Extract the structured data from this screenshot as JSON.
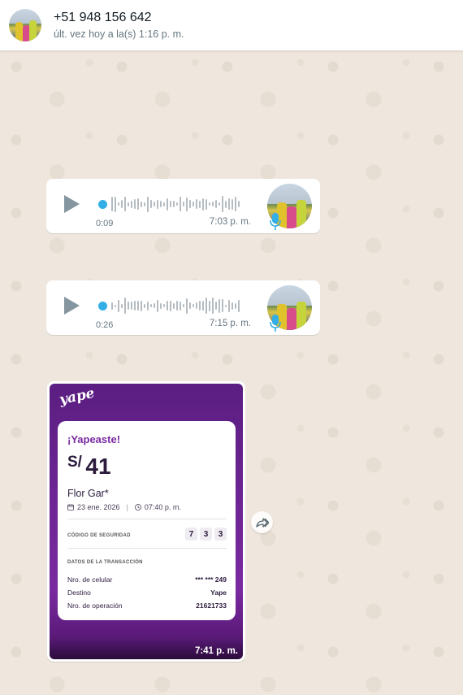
{
  "header": {
    "contact_name": "+51 948 156 642",
    "last_seen": "últ. vez hoy a la(s) 1:16 p. m."
  },
  "voice_notes": [
    {
      "duration": "0:09",
      "time": "7:03 p. m."
    },
    {
      "duration": "0:26",
      "time": "7:15 p. m."
    }
  ],
  "image_message": {
    "time": "7:41 p. m.",
    "yape": {
      "logo": "yape",
      "title": "¡Yapeaste!",
      "currency": "S/",
      "amount": "41",
      "recipient": "Flor Gar*",
      "date": "23 ene. 2026",
      "time": "07:40 p. m.",
      "security_label": "CÓDIGO DE SEGURIDAD",
      "security_code": [
        "7",
        "3",
        "3"
      ],
      "section_label": "DATOS DE LA TRANSACCIÓN",
      "rows": [
        {
          "label": "Nro. de celular",
          "value": "*** *** 249"
        },
        {
          "label": "Destino",
          "value": "Yape"
        },
        {
          "label": "Nro. de operación",
          "value": "21621733"
        }
      ]
    }
  },
  "colors": {
    "chat_background": "#efe7dd",
    "wave_progress": "#34aee6",
    "yape_purple": "#7a2aa0"
  },
  "icons": [
    "play-icon",
    "mic-icon",
    "forward-icon",
    "calendar-icon",
    "clock-icon"
  ]
}
